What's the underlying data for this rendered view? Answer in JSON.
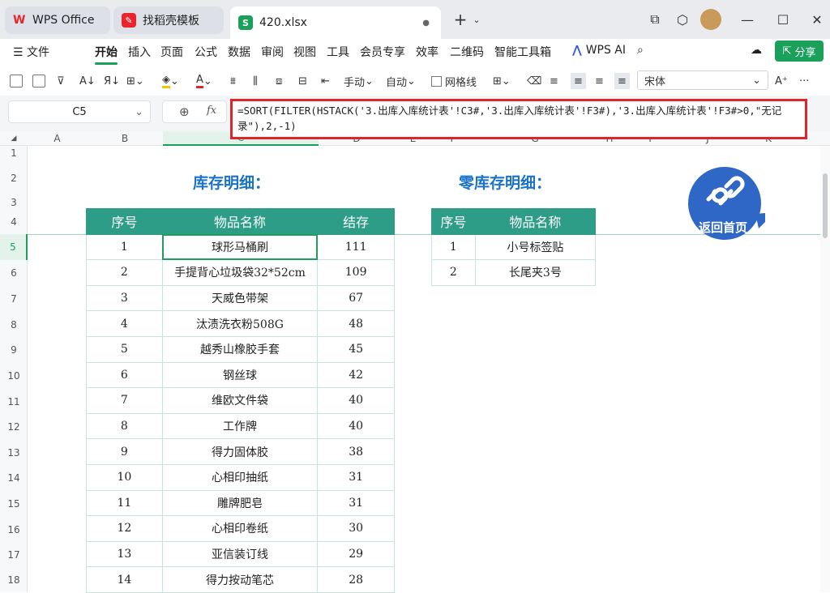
{
  "tabs": [
    {
      "label": "WPS Office"
    },
    {
      "label": "找稻壳模板"
    },
    {
      "label": "420.xlsx"
    }
  ],
  "menu": {
    "file": "文件",
    "items": [
      "开始",
      "插入",
      "页面",
      "公式",
      "数据",
      "审阅",
      "视图",
      "工具",
      "会员专享",
      "效率",
      "二维码",
      "智能工具箱"
    ],
    "ai": "WPS AI",
    "share": "分享"
  },
  "toolbar": {
    "manual": "手动",
    "auto": "自动",
    "gridlines": "网格线",
    "font": "宋体"
  },
  "namebox": "C5",
  "fx": "fx",
  "formula": "=SORT(FILTER(HSTACK('3.出库入库统计表'!C3#,'3.出库入库统计表'!F3#),'3.出库入库统计表'!F3#>0,\"无记录\"),2,-1)",
  "columns": [
    "A",
    "B",
    "C",
    "D",
    "E",
    "F",
    "G",
    "H",
    "I",
    "J",
    "K"
  ],
  "rows": [
    "1",
    "2",
    "3",
    "4",
    "5",
    "6",
    "7",
    "8",
    "9",
    "10",
    "11",
    "12",
    "13",
    "14",
    "15",
    "16",
    "17",
    "18"
  ],
  "left_title": "库存明细：",
  "right_title": "零库存明细：",
  "left_table": {
    "headers": [
      "序号",
      "物品名称",
      "结存"
    ],
    "rows": [
      [
        "1",
        "球形马桶刷",
        "111"
      ],
      [
        "2",
        "手提背心垃圾袋32*52cm",
        "109"
      ],
      [
        "3",
        "天威色带架",
        "67"
      ],
      [
        "4",
        "汰渍洗衣粉508G",
        "48"
      ],
      [
        "5",
        "越秀山橡胶手套",
        "45"
      ],
      [
        "6",
        "钢丝球",
        "42"
      ],
      [
        "7",
        "维欧文件袋",
        "40"
      ],
      [
        "8",
        "工作牌",
        "40"
      ],
      [
        "9",
        "得力固体胶",
        "38"
      ],
      [
        "10",
        "心相印抽纸",
        "31"
      ],
      [
        "11",
        "雕牌肥皂",
        "31"
      ],
      [
        "12",
        "心相印卷纸",
        "30"
      ],
      [
        "13",
        "亚信装订线",
        "29"
      ],
      [
        "14",
        "得力按动笔芯",
        "28"
      ]
    ]
  },
  "right_table": {
    "headers": [
      "序号",
      "物品名称"
    ],
    "rows": [
      [
        "1",
        "小号标签贴"
      ],
      [
        "2",
        "长尾夹3号"
      ]
    ]
  },
  "badge": "返回首页"
}
